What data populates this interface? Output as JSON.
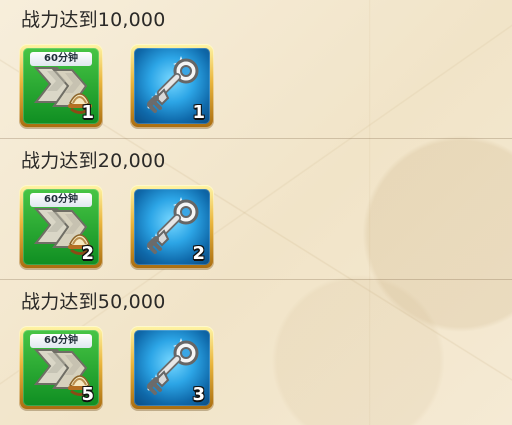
{
  "page": {
    "background_color": "#f3e7cf"
  },
  "milestones": [
    {
      "title": "战力达到10,000",
      "rewards": [
        {
          "type": "speedup",
          "label": "60分钟",
          "icon": "speedup-60m-icon",
          "count": "1"
        },
        {
          "type": "key",
          "icon": "silver-key-icon",
          "count": "1"
        }
      ]
    },
    {
      "title": "战力达到20,000",
      "rewards": [
        {
          "type": "speedup",
          "label": "60分钟",
          "icon": "speedup-60m-icon",
          "count": "2"
        },
        {
          "type": "key",
          "icon": "silver-key-icon",
          "count": "2"
        }
      ]
    },
    {
      "title": "战力达到50,000",
      "rewards": [
        {
          "type": "speedup",
          "label": "60分钟",
          "icon": "speedup-60m-icon",
          "count": "5"
        },
        {
          "type": "key",
          "icon": "silver-key-icon",
          "count": "3"
        }
      ]
    }
  ],
  "colors": {
    "title_text": "#2b2a28",
    "gold_frame": "#e9b53d",
    "green_reward": "#1f9e2d",
    "blue_reward": "#2ca5e6"
  }
}
